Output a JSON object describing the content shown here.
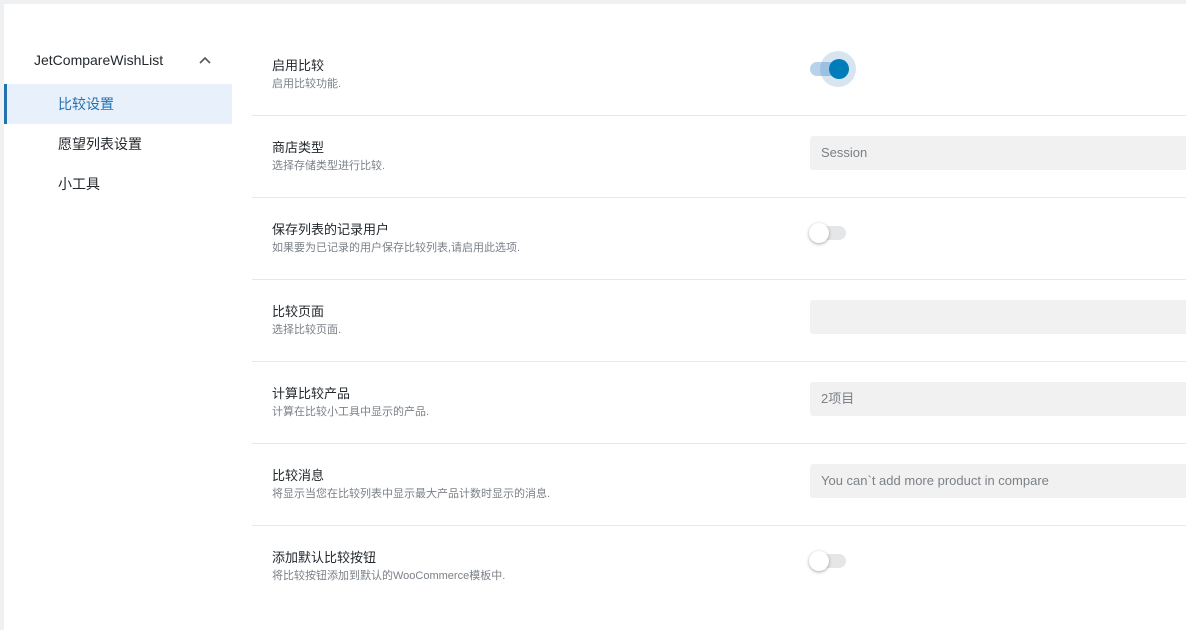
{
  "sidebar": {
    "plugin_title": "JetCompareWishList",
    "items": [
      {
        "label": "比较设置",
        "active": true
      },
      {
        "label": "愿望列表设置",
        "active": false
      },
      {
        "label": "小工具",
        "active": false
      }
    ]
  },
  "settings": [
    {
      "label": "启用比较",
      "desc": "启用比较功能.",
      "control": "toggle",
      "enabled": true
    },
    {
      "label": "商店类型",
      "desc": "选择存储类型进行比较.",
      "control": "select",
      "value": "Session"
    },
    {
      "label": "保存列表的记录用户",
      "desc": "如果要为已记录的用户保存比较列表,请启用此选项.",
      "control": "toggle",
      "enabled": false
    },
    {
      "label": "比较页面",
      "desc": "选择比较页面.",
      "control": "select",
      "value": ""
    },
    {
      "label": "计算比较产品",
      "desc": "计算在比较小工具中显示的产品.",
      "control": "select",
      "value": "2项目"
    },
    {
      "label": "比较消息",
      "desc": "将显示当您在比较列表中显示最大产品计数时显示的消息.",
      "control": "text",
      "value": "You can`t add more product in compare"
    },
    {
      "label": "添加默认比较按钮",
      "desc": "将比较按钮添加到默认的WooCommerce模板中.",
      "control": "toggle",
      "enabled": false
    }
  ],
  "colors": {
    "accent": "#007cba",
    "active_nav_bg": "#e8f0fb",
    "toggle_on_track": "#b9d2ec",
    "input_bg": "#f1f1f1"
  },
  "icons": {
    "collapse": "chevron-up-icon"
  }
}
